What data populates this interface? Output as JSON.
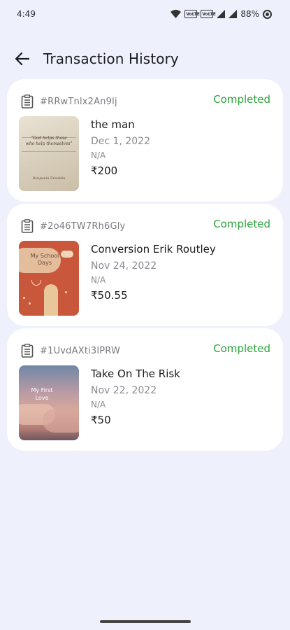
{
  "status_bar": {
    "time": "4:49",
    "battery": "88%"
  },
  "header": {
    "title": "Transaction History"
  },
  "transactions": [
    {
      "id": "#RRwTnlx2An9lj",
      "status": "Completed",
      "title": "the man",
      "date": "Dec 1, 2022",
      "extra": "N/A",
      "price": "₹200",
      "cover_lines": [
        "\"God helps those",
        "who help themselves\""
      ],
      "cover_author": "Benjamin Franklin"
    },
    {
      "id": "#2o46TW7Rh6Gly",
      "status": "Completed",
      "title": "Conversion Erik Routley",
      "date": "Nov 24, 2022",
      "extra": "N/A",
      "price": "₹50.55",
      "cover_lines": [
        "My School",
        "Days"
      ]
    },
    {
      "id": "#1UvdAXti3lPRW",
      "status": "Completed",
      "title": "Take On The Risk",
      "date": "Nov 22, 2022",
      "extra": "N/A",
      "price": "₹50",
      "cover_lines": [
        "My First",
        "Love"
      ]
    }
  ],
  "colors": {
    "background": "#eef0fc",
    "status_completed": "#2aa33a"
  },
  "icons": [
    "wifi-icon",
    "signal-icon",
    "battery-icon",
    "back-arrow-icon",
    "clipboard-icon"
  ]
}
